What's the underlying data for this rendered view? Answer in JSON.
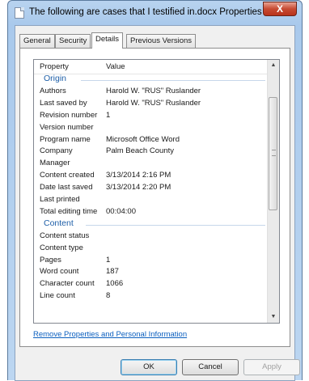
{
  "window": {
    "title": "The following are cases that I testified in.docx Properties",
    "close_glyph": "X"
  },
  "tabs": [
    {
      "label": "General",
      "active": false
    },
    {
      "label": "Security",
      "active": false
    },
    {
      "label": "Details",
      "active": true
    },
    {
      "label": "Previous Versions",
      "active": false
    }
  ],
  "list": {
    "header": {
      "property": "Property",
      "value": "Value"
    },
    "origin_group": "Origin",
    "origin_rows": [
      {
        "k": "Authors",
        "v": "Harold W. \"RUS\" Ruslander"
      },
      {
        "k": "Last saved by",
        "v": "Harold W. \"RUS\" Ruslander"
      },
      {
        "k": "Revision number",
        "v": "1"
      },
      {
        "k": "Version number",
        "v": ""
      },
      {
        "k": "Program name",
        "v": "Microsoft Office Word"
      },
      {
        "k": "Company",
        "v": "Palm Beach County"
      },
      {
        "k": "Manager",
        "v": ""
      },
      {
        "k": "Content created",
        "v": "3/13/2014 2:16 PM"
      },
      {
        "k": "Date last saved",
        "v": "3/13/2014 2:20 PM"
      },
      {
        "k": "Last printed",
        "v": ""
      },
      {
        "k": "Total editing time",
        "v": "00:04:00"
      }
    ],
    "content_group": "Content",
    "content_rows": [
      {
        "k": "Content status",
        "v": ""
      },
      {
        "k": "Content type",
        "v": ""
      },
      {
        "k": "Pages",
        "v": "1"
      },
      {
        "k": "Word count",
        "v": "187"
      },
      {
        "k": "Character count",
        "v": "1066"
      },
      {
        "k": "Line count",
        "v": "8"
      }
    ],
    "scroll_up": "▲",
    "scroll_down": "▼"
  },
  "remove_link": "Remove Properties and Personal Information",
  "buttons": {
    "ok": "OK",
    "cancel": "Cancel",
    "apply": "Apply"
  }
}
